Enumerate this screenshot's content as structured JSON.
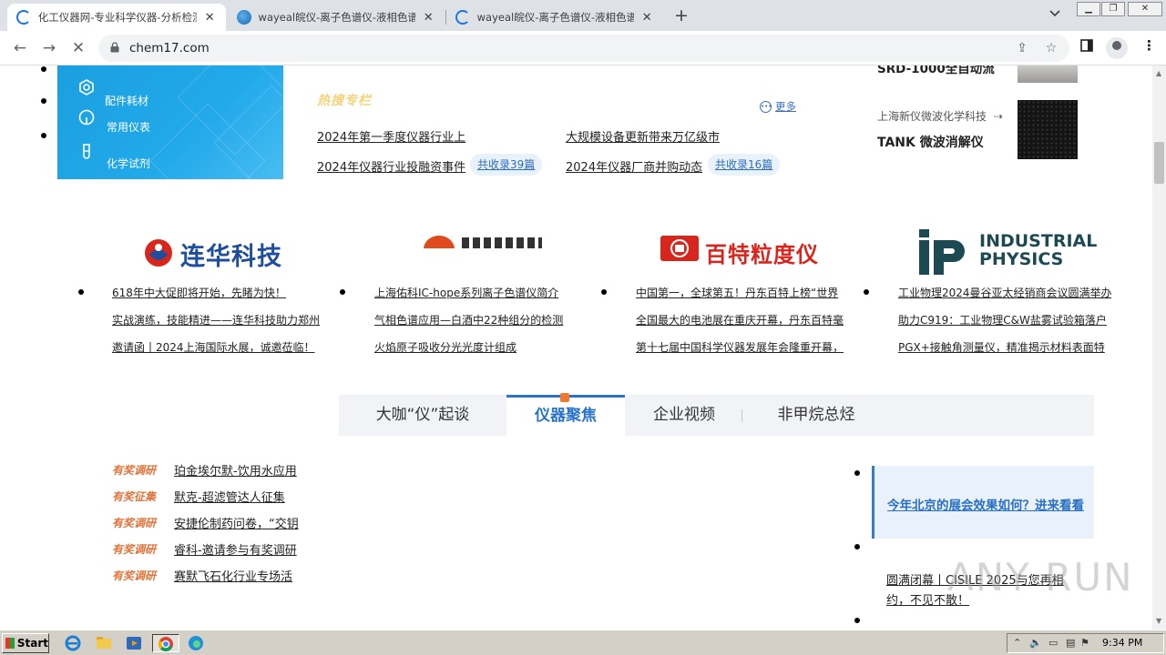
{
  "browser": {
    "tabs": [
      {
        "title": "化工仪器网-专业科学仪器-分析检测",
        "close": "✕",
        "icon": "loading-spinner"
      },
      {
        "title": "wayeal皖仪-离子色谱仪-液相色谱仪",
        "close": "✕",
        "icon": "wayeal-favicon"
      },
      {
        "title": "wayeal皖仪-离子色谱仪-液相色谱仪",
        "close": "✕",
        "icon": "loading-spinner"
      }
    ],
    "new_tab": "+",
    "url": "chem17.com"
  },
  "panel": {
    "items": [
      {
        "label": "配件耗材",
        "icon": "hexagon-nut-icon"
      },
      {
        "label": "常用仪表",
        "icon": "gauge-icon"
      },
      {
        "label": "化学试剂",
        "icon": "flask-icon"
      }
    ]
  },
  "hot": {
    "title": "热搜专栏",
    "more": "更多",
    "links": [
      "2024年第一季度仪器行业上",
      "大规模设备更新带来万亿级市",
      "2024年仪器行业投融资事件",
      "2024年仪器厂商并购动态"
    ],
    "badges": [
      "共收录39篇",
      "共收录16篇"
    ]
  },
  "right_cards": [
    {
      "title": "SRD-1000全自动流"
    },
    {
      "company": "上海新仪微波化学科技",
      "title": "TANK 微波消解仪"
    }
  ],
  "logos": [
    {
      "name": "连华科技"
    },
    {
      "name": ""
    },
    {
      "name": "百特粒度仪"
    },
    {
      "name": "INDUSTRIAL PHYSICS",
      "line1": "INDUSTRIAL",
      "line2": "PHYSICS"
    }
  ],
  "news_columns": [
    [
      "618年中大促即将开始，先睹为快！",
      "实战演练，技能精进——连华科技助力郑州",
      "邀请函丨2024上海国际水展，诚邀莅临！"
    ],
    [
      "上海佑科IC-hope系列离子色谱仪简介",
      "气相色谱应用—白酒中22种组分的检测",
      "火焰原子吸收分光光度计组成"
    ],
    [
      "中国第一，全球第五！丹东百特上榜“世界",
      "全国最大的电池展在重庆开幕，丹东百特毫",
      "第十七届中国科学仪器发展年会隆重开幕，"
    ],
    [
      "工业物理2024曼谷亚太经销商会议圆满举办",
      "助力C919：工业物理C&W盐雾试验箱落户",
      "PGX+接触角测量仪，精准揭示材料表面特"
    ]
  ],
  "content_tabs": [
    "大咖“仪”起谈",
    "仪器聚焦",
    "企业视频",
    "非甲烷总烃"
  ],
  "surveys": [
    {
      "tag": "有奖调研",
      "text": "珀金埃尔默-饮用水应用"
    },
    {
      "tag": "有奖征集",
      "text": "默克-超滤管达人征集"
    },
    {
      "tag": "有奖调研",
      "text": "安捷伦制药问卷，“交钥"
    },
    {
      "tag": "有奖调研",
      "text": "睿科-邀请参与有奖调研"
    },
    {
      "tag": "有奖调研",
      "text": "赛默飞石化行业专场活"
    }
  ],
  "side": {
    "highlight": "今年北京的展会效果如何？进来看看",
    "item2": "圆满闭幕丨CISILE 2025与您再相约，不见不散！"
  },
  "watermark": "ANY RUN",
  "taskbar": {
    "start": "Start",
    "clock": "9:34 PM"
  }
}
